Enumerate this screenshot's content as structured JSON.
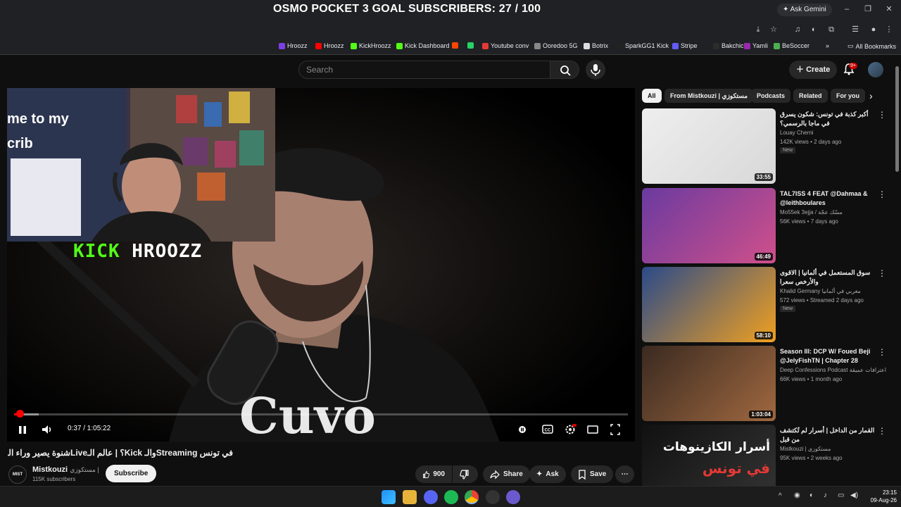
{
  "overlay": {
    "stream_title": "OSMO POCKET 3 GOAL SUBSCRIBERS: 27 / 100",
    "brand": {
      "kick": "KICK",
      "name": "HROOZZ"
    },
    "webcam_sign": "me to my\ncrib"
  },
  "browser": {
    "ask_gemini": "Ask Gemini",
    "bookmarks": [
      {
        "label": "Hroozz",
        "color": "#7b3fe4"
      },
      {
        "label": "Hroozz",
        "color": "#ff0000"
      },
      {
        "label": "KickHroozz",
        "color": "#53fc18"
      },
      {
        "label": "Kick Dashboard",
        "color": "#53fc18"
      },
      {
        "label": "",
        "color": "#ff4500"
      },
      {
        "label": "",
        "color": "#25d366"
      },
      {
        "label": "Youtube conv",
        "color": "#e53935"
      },
      {
        "label": "Ooredoo 5G",
        "color": "#888888"
      },
      {
        "label": "Botrix",
        "color": "#dddddd"
      },
      {
        "label": "SparkGG1 Kick",
        "color": "#222222"
      },
      {
        "label": "Stripe",
        "color": "#635bff"
      },
      {
        "label": "Bakchich",
        "color": "#2c2c2c"
      },
      {
        "label": "Yamli",
        "color": "#9c27b0"
      },
      {
        "label": "BeSoccer",
        "color": "#4caf50"
      }
    ],
    "all_bookmarks": "All Bookmarks"
  },
  "header": {
    "search_placeholder": "Search",
    "create_label": "Create",
    "notif_count": "9+"
  },
  "player": {
    "time": "0:37 / 1:05:22",
    "progress": 0.0094,
    "buffered": 0.04
  },
  "video": {
    "title": "في تونس Streamingوالـ Kick؟ | عالم الـLiveشنوة يصير وراء الـ",
    "channel_name": "Mistkouzi",
    "channel_name_ar": "مستكوزي |",
    "channel_logo": "MIST KO ZI",
    "subscribers": "115K subscribers",
    "subscribe_label": "Subscribe",
    "likes": "900",
    "share_label": "Share",
    "ask_label": "Ask",
    "save_label": "Save"
  },
  "chips": [
    "All",
    "From Mistkouzi | مستكوزي",
    "Podcasts",
    "Related",
    "For you"
  ],
  "recommendations": [
    {
      "title": "أكبر كذبة في تونس: شكون يسرق في ماجا بالرسمي؟",
      "channel": "Louay Cherni",
      "meta": "142K views • 2 days ago",
      "badge": "New",
      "duration": "33:55",
      "thumb_colors": [
        "#eeeeee",
        "#d8d8d8"
      ]
    },
    {
      "title": "TAL7ISS 4 FEAT @Dahmaa & @leithboulares",
      "channel": "Mo55ek 3ejja / مسّك عجّة",
      "meta": "56K views • 7 days ago",
      "badge": "",
      "duration": "46:49",
      "thumb_colors": [
        "#6a3aa0",
        "#d0508a"
      ]
    },
    {
      "title": "سوق المستعمل في ألمانيا | الاقوى والأرخص سعرا",
      "channel": "Khalid Germany مغربي في ألمانيا",
      "meta": "572 views • Streamed 2 days ago",
      "badge": "New",
      "duration": "58:10",
      "thumb_colors": [
        "#2a4a8a",
        "#f0a020"
      ]
    },
    {
      "title": "Season III: DCP W/ Foued Beji @JelyFishTN | Chapter 28",
      "channel": "Deep Confessions Podcast اعترافات عميقة",
      "meta": "66K views • 1 month ago",
      "badge": "",
      "duration": "1:03:04",
      "thumb_colors": [
        "#3a2a20",
        "#a06840"
      ]
    },
    {
      "title": "القمار من الداخل | أسرار لم تُكتشف من قبل",
      "channel": "Mistkouzi | مستكوزي",
      "meta": "95K views • 2 weeks ago",
      "badge": "",
      "duration": "",
      "thumb_colors": [
        "#111111",
        "#333333"
      ],
      "thumb_text": [
        "أسرار الكازينوهات",
        "في تونس"
      ]
    }
  ],
  "taskbar": {
    "time": "23:15",
    "date": "09-Aug-26"
  }
}
